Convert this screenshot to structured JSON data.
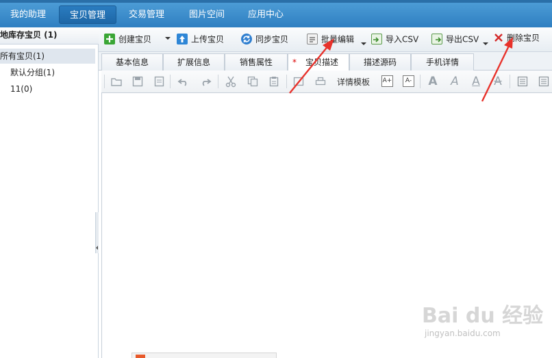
{
  "nav": {
    "items": [
      {
        "label": "我的助理"
      },
      {
        "label": "宝贝管理"
      },
      {
        "label": "交易管理"
      },
      {
        "label": "图片空间"
      },
      {
        "label": "应用中心"
      }
    ]
  },
  "sidebar": {
    "title": "地库存宝贝 (1)",
    "items": [
      {
        "label": "所有宝贝(1)"
      },
      {
        "label": "默认分组(1)"
      },
      {
        "label": "11(0)"
      }
    ]
  },
  "toolbar": {
    "create": "创建宝贝",
    "upload": "上传宝贝",
    "sync": "同步宝贝",
    "batch_edit": "批量编辑",
    "import_csv": "导入CSV",
    "export_csv": "导出CSV",
    "delete": "删除宝贝"
  },
  "tabs": [
    {
      "label": "基本信息"
    },
    {
      "label": "扩展信息"
    },
    {
      "label": "销售属性"
    },
    {
      "label": "宝贝描述",
      "marker": "*"
    },
    {
      "label": "描述源码"
    },
    {
      "label": "手机详情"
    }
  ],
  "editor_toolbar": {
    "template_label": "详情模板",
    "font_up": "A+",
    "font_down": "A-"
  },
  "watermark": {
    "logo": "Bai du 经验",
    "url": "jingyan.baidu.com"
  },
  "colors": {
    "nav_bg": "#3a8bcb",
    "nav_active": "#1e67a7",
    "annotation_arrow": "#e8322b"
  }
}
